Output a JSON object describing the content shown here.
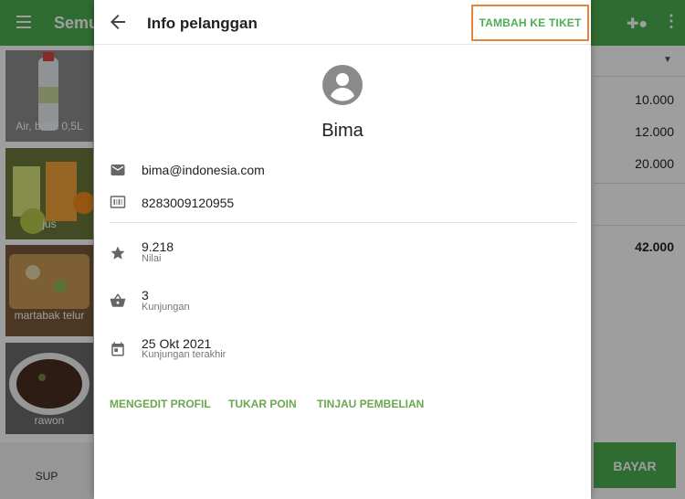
{
  "background": {
    "title": "Semu",
    "items": [
      {
        "label": "Air, botol 0,5L"
      },
      {
        "label": "jus"
      },
      {
        "label": "martabak telur"
      },
      {
        "label": "rawon"
      },
      {
        "label": "SUP"
      }
    ],
    "prices": [
      "10.000",
      "12.000",
      "20.000"
    ],
    "total": "42.000",
    "pay_label": "BAYAR"
  },
  "dialog": {
    "title": "Info pelanggan",
    "add_to_ticket_label": "TAMBAH KE TIKET",
    "customer_name": "Bima",
    "email": "bima@indonesia.com",
    "card_number": "8283009120955",
    "points_value": "9.218",
    "points_label": "Nilai",
    "visits_value": "3",
    "visits_label": "Kunjungan",
    "last_visit_value": "25 Okt 2021",
    "last_visit_label": "Kunjungan terakhir",
    "actions": {
      "edit_profile": "MENGEDIT PROFIL",
      "redeem_points": "TUKAR POIN",
      "view_purchases": "TINJAU PEMBELIAN"
    }
  },
  "colors": {
    "primary": "#4caf50",
    "highlight_border": "#e8833a",
    "action_text": "#6aa84f"
  }
}
